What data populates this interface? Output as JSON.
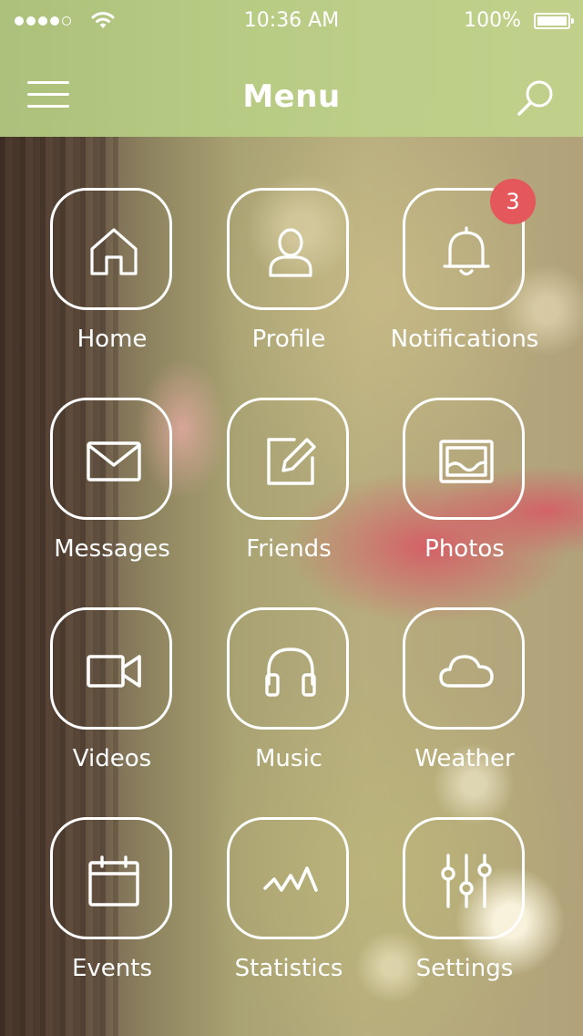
{
  "status_bar": {
    "time": "10:36 AM",
    "battery": "100%",
    "signal_icon": "signal-dots-icon",
    "wifi_icon": "wifi-icon",
    "battery_icon": "battery-icon"
  },
  "header": {
    "title": "Menu",
    "menu_icon": "hamburger-menu-icon",
    "search_icon": "search-icon",
    "background_color": "#b9cf88"
  },
  "menu": {
    "items": [
      {
        "label": "Home",
        "icon": "home-icon"
      },
      {
        "label": "Profile",
        "icon": "profile-icon"
      },
      {
        "label": "Notifications",
        "icon": "bell-icon",
        "badge": "3"
      },
      {
        "label": "Messages",
        "icon": "envelope-icon"
      },
      {
        "label": "Friends",
        "icon": "edit-icon"
      },
      {
        "label": "Photos",
        "icon": "photo-icon"
      },
      {
        "label": "Videos",
        "icon": "video-camera-icon"
      },
      {
        "label": "Music",
        "icon": "headphones-icon"
      },
      {
        "label": "Weather",
        "icon": "cloud-icon"
      },
      {
        "label": "Events",
        "icon": "calendar-icon"
      },
      {
        "label": "Statistics",
        "icon": "activity-icon"
      },
      {
        "label": "Settings",
        "icon": "sliders-icon"
      }
    ]
  },
  "colors": {
    "badge": "#e4575a",
    "icon_stroke": "#ffffff"
  }
}
